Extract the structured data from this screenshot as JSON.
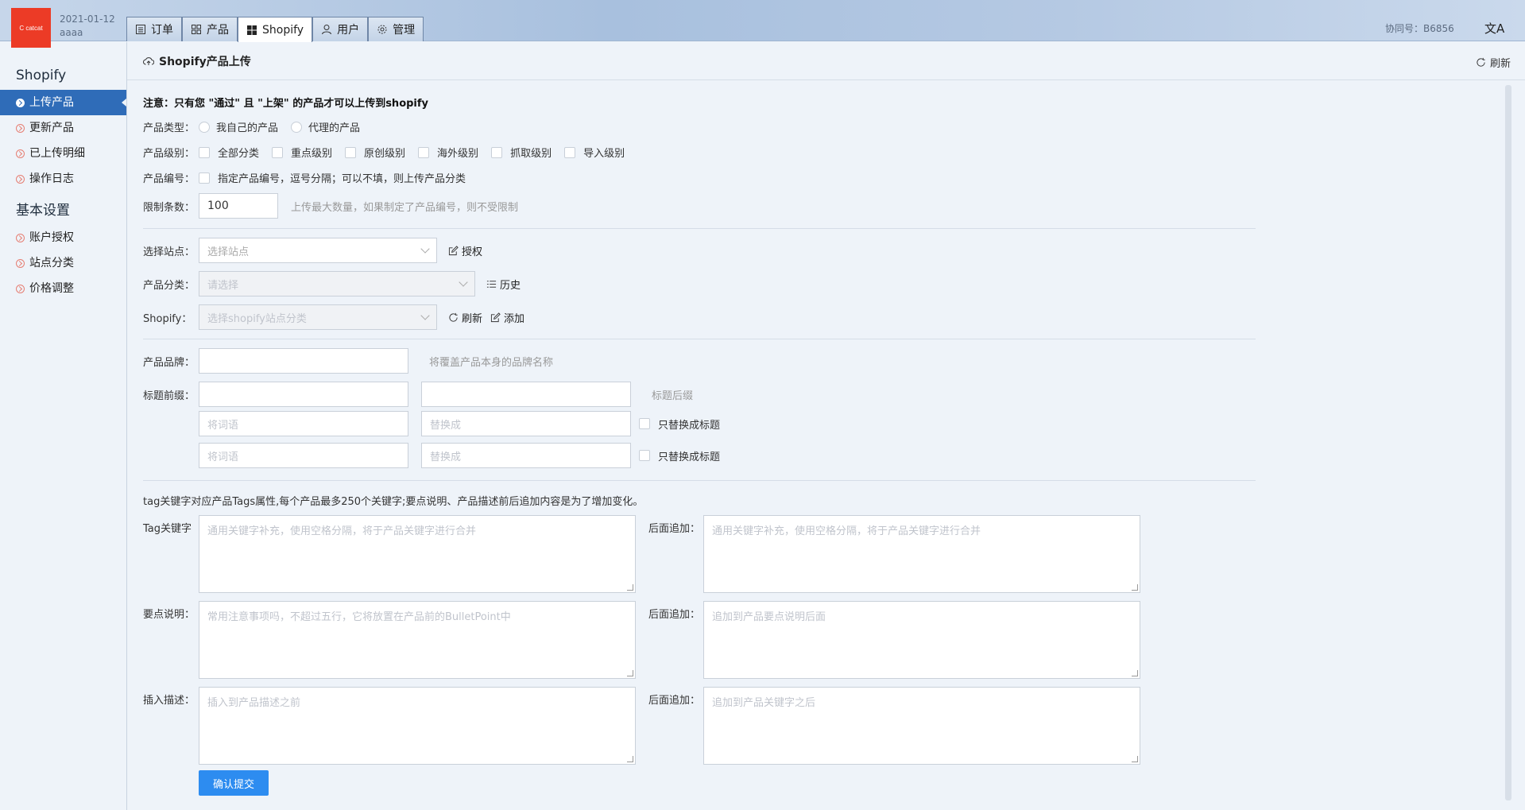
{
  "topbar": {
    "logo_text": "C catcat",
    "date": "2021-01-12",
    "user": "aaaa",
    "tabs": [
      {
        "label": "订单",
        "icon": "list-icon"
      },
      {
        "label": "产品",
        "icon": "grid-icon"
      },
      {
        "label": "Shopify",
        "icon": "grid-filled-icon",
        "active": true
      },
      {
        "label": "用户",
        "icon": "user-icon"
      },
      {
        "label": "管理",
        "icon": "gear-icon"
      }
    ],
    "xiehao": "协同号：B6856",
    "lang_icon": "文A"
  },
  "sidebar": {
    "section1": "Shopify",
    "items1": [
      "上传产品",
      "更新产品",
      "已上传明细",
      "操作日志"
    ],
    "section2": "基本设置",
    "items2": [
      "账户授权",
      "站点分类",
      "价格调整"
    ]
  },
  "header": {
    "title": "Shopify产品上传",
    "refresh": "刷新"
  },
  "form": {
    "note": "注意：只有您 \"通过\" 且 \"上架\" 的产品才可以上传到shopify",
    "type_label": "产品类型：",
    "type_options": [
      "我自己的产品",
      "代理的产品"
    ],
    "level_label": "产品级别：",
    "level_options": [
      "全部分类",
      "重点级别",
      "原创级别",
      "海外级别",
      "抓取级别",
      "导入级别"
    ],
    "code_label": "产品编号：",
    "code_hint": "指定产品编号，逗号分隔；可以不填，则上传产品分类",
    "limit_label": "限制条数：",
    "limit_value": "100",
    "limit_hint": "上传最大数量，如果制定了产品编号，则不受限制",
    "site_label": "选择站点：",
    "site_placeholder": "选择站点",
    "auth_link": "授权",
    "category_label": "产品分类：",
    "category_placeholder": "请选择",
    "history_link": "历史",
    "shopify_label": "Shopify：",
    "shopify_placeholder": "选择shopify站点分类",
    "shopify_refresh": "刷新",
    "shopify_add": "添加",
    "brand_label": "产品品牌：",
    "brand_hint": "将覆盖产品本身的品牌名称",
    "prefix_label": "标题前缀：",
    "suffix_hint": "标题后缀",
    "replace_ph1": "将词语",
    "replace_ph2": "替换成",
    "replace_only": "只替换成标题",
    "tag_note": "tag关键字对应产品Tags属性,每个产品最多250个关键字;要点说明、产品描述前后追加内容是为了增加变化。",
    "tag_label": "Tag关键字",
    "tag_ph": "通用关键字补充，使用空格分隔，将于产品关键字进行合并",
    "append_label": "后面追加：",
    "append_tag_ph": "通用关键字补充，使用空格分隔，将于产品关键字进行合并",
    "bullet_label": "要点说明：",
    "bullet_ph": "常用注意事项吗，不超过五行，它将放置在产品前的BulletPoint中",
    "append_bullet_ph": "追加到产品要点说明后面",
    "desc_label": "插入描述：",
    "desc_ph": "插入到产品描述之前",
    "append_desc_ph": "追加到产品关键字之后",
    "submit": "确认提交"
  }
}
